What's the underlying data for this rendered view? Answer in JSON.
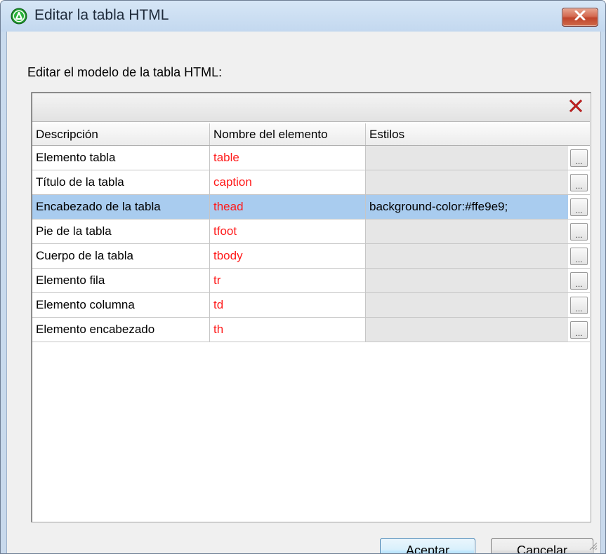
{
  "window": {
    "title": "Editar la tabla HTML",
    "icon": "altova-app-icon",
    "close_icon": "close-x-icon"
  },
  "dialog": {
    "prompt": "Editar el modelo de la tabla HTML:"
  },
  "toolbar": {
    "delete_icon": "delete-x-icon"
  },
  "table": {
    "headers": [
      "Descripción",
      "Nombre del elemento",
      "Estilos"
    ],
    "selected_row": 2,
    "rows": [
      {
        "description": "Elemento tabla",
        "element": "table",
        "styles": "",
        "button": "..."
      },
      {
        "description": "Título de la tabla",
        "element": "caption",
        "styles": "",
        "button": "..."
      },
      {
        "description": "Encabezado de la tabla",
        "element": "thead",
        "styles": "background-color:#ffe9e9;",
        "button": "..."
      },
      {
        "description": "Pie de la tabla",
        "element": "tfoot",
        "styles": "",
        "button": "..."
      },
      {
        "description": "Cuerpo de la tabla",
        "element": "tbody",
        "styles": "",
        "button": "..."
      },
      {
        "description": "Elemento fila",
        "element": "tr",
        "styles": "",
        "button": "..."
      },
      {
        "description": "Elemento columna",
        "element": "td",
        "styles": "",
        "button": "..."
      },
      {
        "description": "Elemento encabezado",
        "element": "th",
        "styles": "",
        "button": "..."
      }
    ]
  },
  "buttons": {
    "accept": "Aceptar",
    "cancel": "Cancelar"
  },
  "colors": {
    "element_name": "#ff1a1a",
    "selection": "#a9ccef",
    "styles_cell_bg": "#e6e6e6"
  }
}
